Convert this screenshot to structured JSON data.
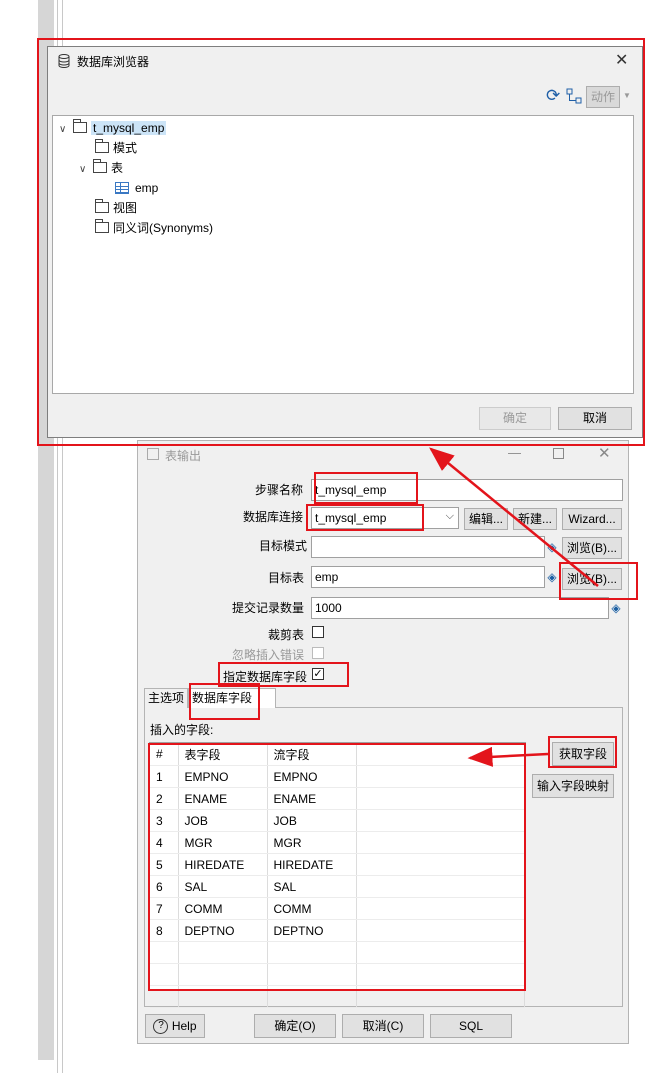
{
  "browser_dialog": {
    "title": "数据库浏览器",
    "action_label": "动作",
    "tree": {
      "root": "t_mysql_emp",
      "schemas": "模式",
      "tables": "表",
      "table_item": "emp",
      "views": "视图",
      "synonyms": "同义词(Synonyms)"
    },
    "ok_label": "确定",
    "cancel_label": "取消"
  },
  "table_output_dialog": {
    "title": "表输出",
    "fields": {
      "step_name_label": "步骤名称",
      "step_name_value": "t_mysql_emp",
      "db_connection_label": "数据库连接",
      "db_connection_value": "t_mysql_emp",
      "edit_label": "编辑...",
      "new_label": "新建...",
      "wizard_label": "Wizard...",
      "target_schema_label": "目标模式",
      "target_schema_value": "",
      "browse_label": "浏览(B)...",
      "target_table_label": "目标表",
      "target_table_value": "emp",
      "commit_size_label": "提交记录数量",
      "commit_size_value": "1000",
      "truncate_label": "裁剪表",
      "ignore_errors_label": "忽略插入错误",
      "specify_fields_label": "指定数据库字段"
    },
    "tabs": [
      "主选项",
      "数据库字段"
    ],
    "insert_fields_label": "插入的字段:",
    "grid": {
      "headers": [
        "#",
        "表字段",
        "流字段"
      ],
      "rows": [
        [
          "1",
          "EMPNO",
          "EMPNO"
        ],
        [
          "2",
          "ENAME",
          "ENAME"
        ],
        [
          "3",
          "JOB",
          "JOB"
        ],
        [
          "4",
          "MGR",
          "MGR"
        ],
        [
          "5",
          "HIREDATE",
          "HIREDATE"
        ],
        [
          "6",
          "SAL",
          "SAL"
        ],
        [
          "7",
          "COMM",
          "COMM"
        ],
        [
          "8",
          "DEPTNO",
          "DEPTNO"
        ]
      ]
    },
    "get_fields_label": "获取字段",
    "map_fields_label": "输入字段映射",
    "help_label": "Help",
    "ok_label": "确定(O)",
    "cancel_label": "取消(C)",
    "sql_label": "SQL"
  },
  "colors": {
    "annotation_red": "#e3141b",
    "selection_blue": "#cce4f7"
  }
}
